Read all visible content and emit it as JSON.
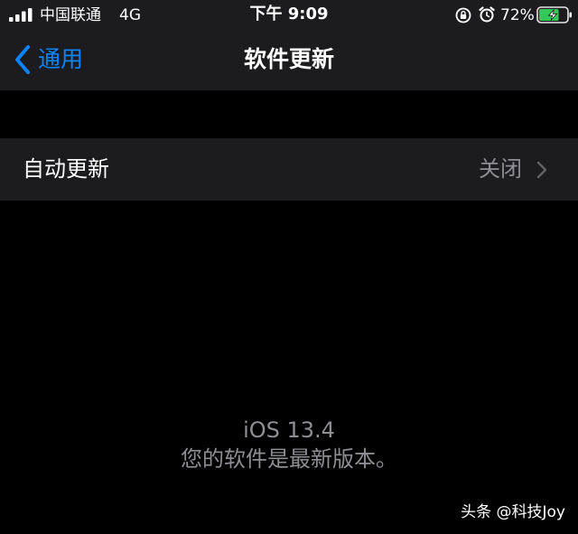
{
  "status_bar": {
    "carrier": "中国联通",
    "network": "4G",
    "time": "下午 9:09",
    "battery_percent": "72%",
    "battery_level": 0.72,
    "icons": [
      "signal-icon",
      "orientation-lock-icon",
      "alarm-icon",
      "battery-charging-icon"
    ]
  },
  "nav": {
    "back_label": "通用",
    "title": "软件更新"
  },
  "auto_update": {
    "label": "自动更新",
    "value": "关闭"
  },
  "info": {
    "version": "iOS 13.4",
    "status": "您的软件是最新版本。"
  },
  "watermark": "头条 @科技Joy",
  "colors": {
    "accent": "#0a84ff",
    "secondary_text": "#8e8e93",
    "surface": "#1c1c1e",
    "background": "#000000",
    "battery_fill": "#34c759"
  }
}
